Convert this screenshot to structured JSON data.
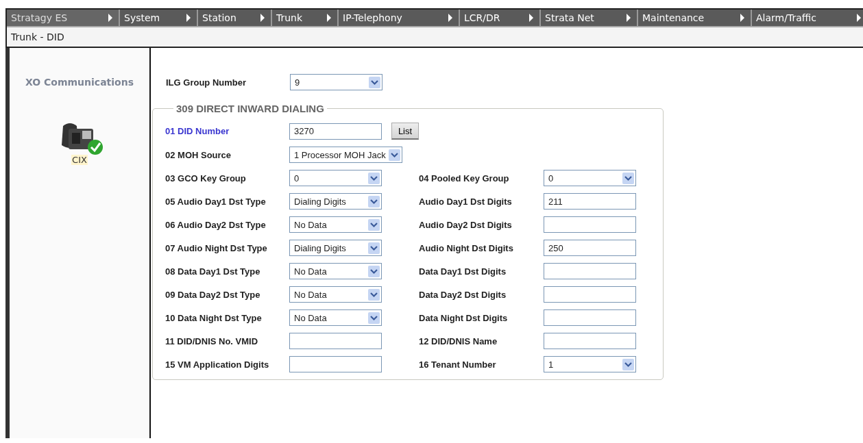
{
  "menu": [
    {
      "label": "Stratagy ES",
      "selected": true
    },
    {
      "label": "System",
      "selected": false
    },
    {
      "label": "Station",
      "selected": false
    },
    {
      "label": "Trunk",
      "selected": false
    },
    {
      "label": "IP-Telephony",
      "selected": false
    },
    {
      "label": "LCR/DR",
      "selected": false
    },
    {
      "label": "Strata Net",
      "selected": false
    },
    {
      "label": "Maintenance",
      "selected": false
    },
    {
      "label": "Alarm/Traffic",
      "selected": false
    }
  ],
  "breadcrumb": "Trunk - DID",
  "sidebar": {
    "title": "XO Communications",
    "device": {
      "label": "CIX",
      "online": true
    }
  },
  "group_field": {
    "label": "ILG Group Number",
    "kind": "select",
    "value": "9"
  },
  "section": {
    "title": "309 DIRECT INWARD DIALING",
    "rows": [
      {
        "left": {
          "label": "01 DID Number",
          "kind": "text",
          "value": "3270",
          "highlighted": true,
          "button": "List"
        }
      },
      {
        "left": {
          "label": "02 MOH Source",
          "kind": "select",
          "value": "1 Processor MOH Jack",
          "highlighted": false
        }
      },
      {
        "left": {
          "label": "03 GCO Key Group",
          "kind": "select",
          "value": "0",
          "highlighted": false
        },
        "right": {
          "label": "04 Pooled Key Group",
          "kind": "select",
          "value": "0",
          "highlighted": false
        }
      },
      {
        "left": {
          "label": "05 Audio Day1 Dst Type",
          "kind": "select",
          "value": "Dialing Digits",
          "highlighted": false
        },
        "right": {
          "label": "Audio Day1 Dst Digits",
          "kind": "text",
          "value": "211",
          "highlighted": false
        }
      },
      {
        "left": {
          "label": "06 Audio Day2 Dst Type",
          "kind": "select",
          "value": "No Data",
          "highlighted": false
        },
        "right": {
          "label": "Audio Day2 Dst Digits",
          "kind": "text",
          "highlighted": false
        }
      },
      {
        "left": {
          "label": "07 Audio Night Dst Type",
          "kind": "select",
          "value": "Dialing Digits",
          "highlighted": false
        },
        "right": {
          "label": "Audio Night Dst Digits",
          "kind": "text",
          "value": "250",
          "highlighted": false
        }
      },
      {
        "left": {
          "label": "08 Data Day1 Dst Type",
          "kind": "select",
          "value": "No Data",
          "highlighted": false
        },
        "right": {
          "label": "Data Day1 Dst Digits",
          "kind": "text",
          "highlighted": false
        }
      },
      {
        "left": {
          "label": "09 Data Day2 Dst Type",
          "kind": "select",
          "value": "No Data",
          "highlighted": false
        },
        "right": {
          "label": "Data Day2 Dst Digits",
          "kind": "text",
          "highlighted": false
        }
      },
      {
        "left": {
          "label": "10 Data Night Dst Type",
          "kind": "select",
          "value": "No Data",
          "highlighted": false
        },
        "right": {
          "label": "Data Night Dst Digits",
          "kind": "text",
          "highlighted": false
        }
      },
      {
        "left": {
          "label": "11 DID/DNIS No. VMID",
          "kind": "text",
          "highlighted": false
        },
        "right": {
          "label": "12 DID/DNIS Name",
          "kind": "text",
          "highlighted": false
        }
      },
      {
        "left": {
          "label": "15 VM Application Digits",
          "kind": "text",
          "highlighted": false
        },
        "right": {
          "label": "16 Tenant Number",
          "kind": "select",
          "value": "1",
          "highlighted": false
        }
      }
    ]
  }
}
